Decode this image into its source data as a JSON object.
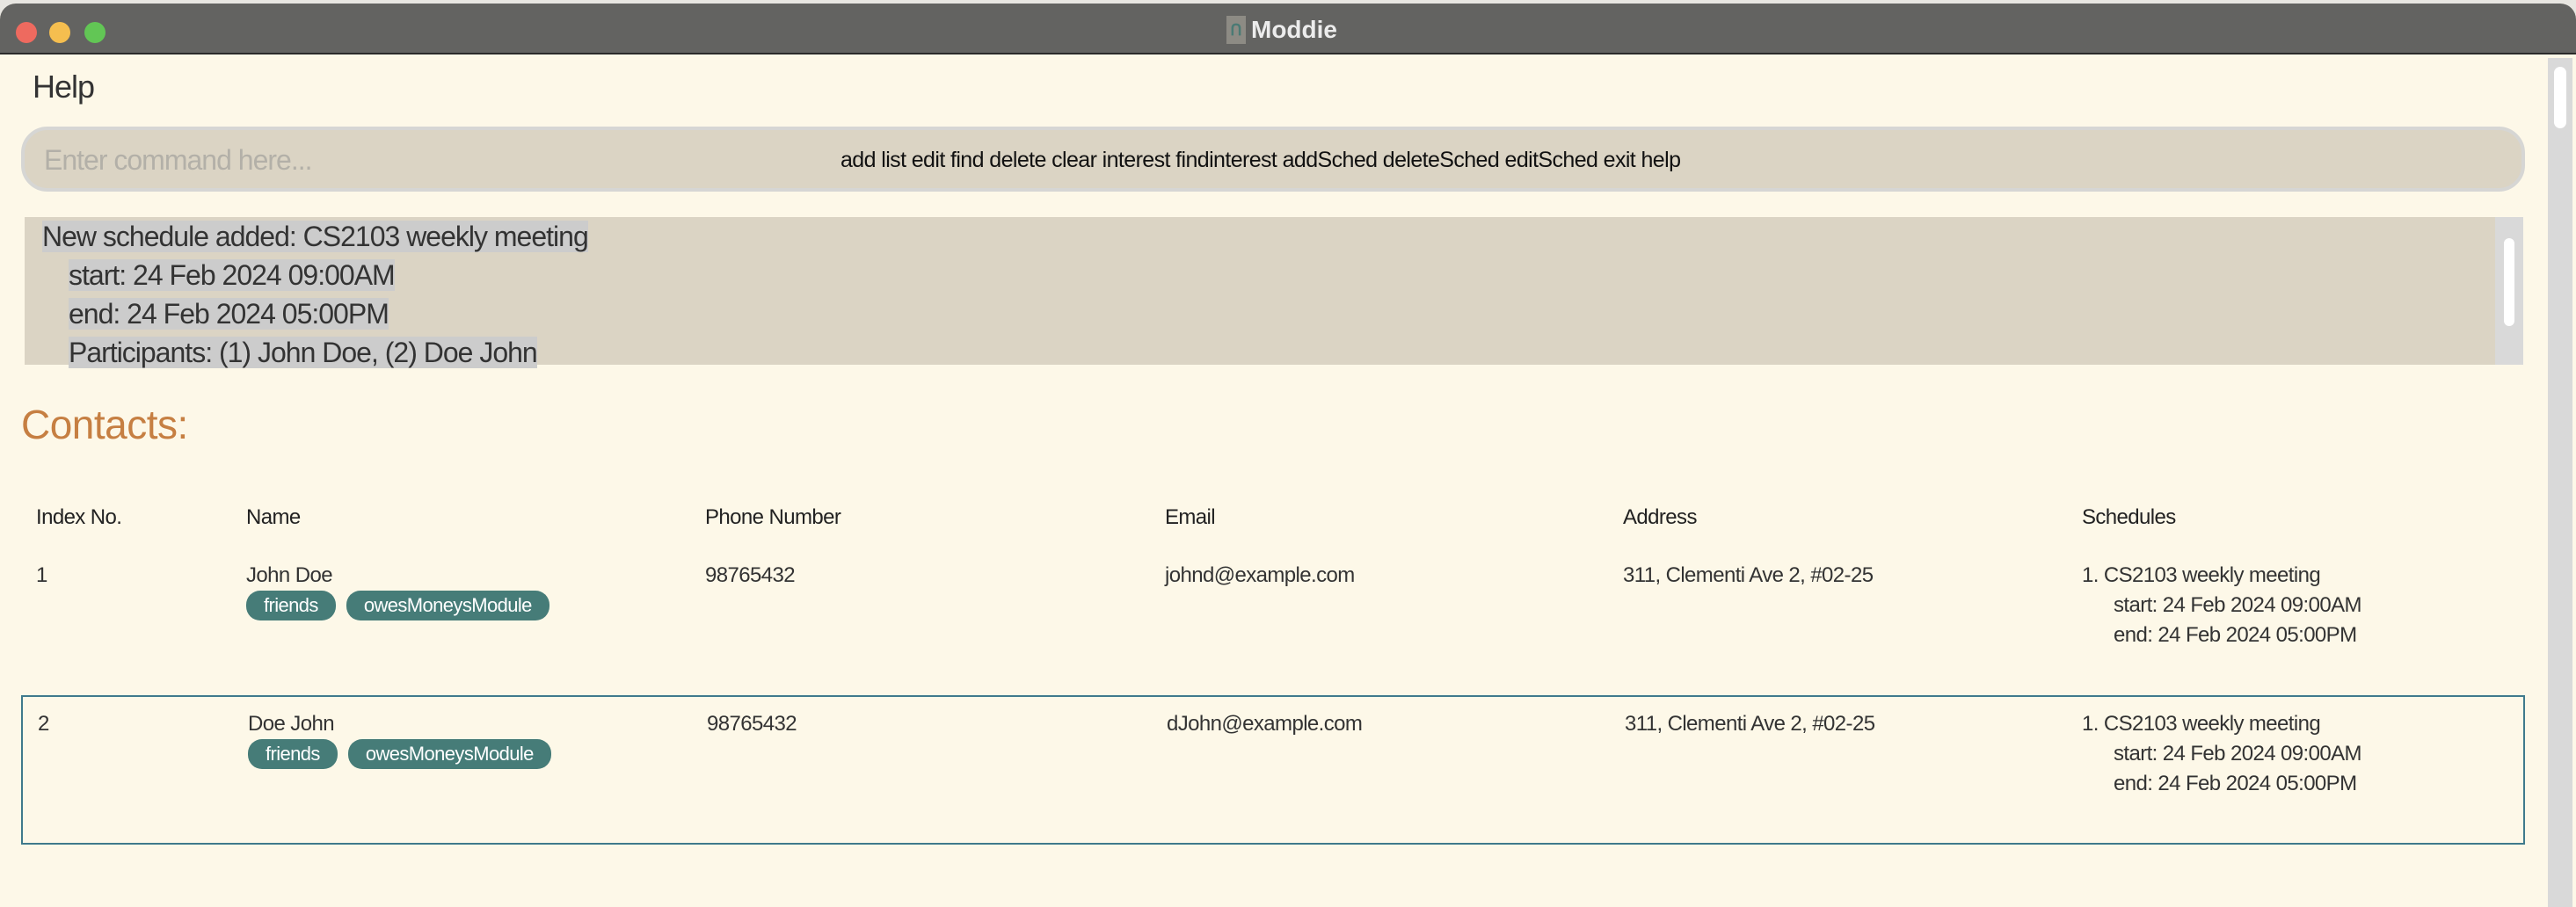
{
  "window": {
    "title": "Moddie",
    "app_icon": "moddie-logo-icon"
  },
  "menu": {
    "help": "Help"
  },
  "command": {
    "placeholder": "Enter command here...",
    "value": "",
    "hints": "add list edit find delete clear interest findinterest addSched deleteSched editSched exit help"
  },
  "result": {
    "lines": [
      "New schedule added: CS2103 weekly meeting",
      "start: 24 Feb 2024 09:00AM",
      "end: 24 Feb 2024 05:00PM",
      "Participants: (1) John Doe, (2) Doe John"
    ]
  },
  "contacts": {
    "title": "Contacts:",
    "headers": [
      "Index No.",
      "Name",
      "Phone Number",
      "Email",
      "Address",
      "Schedules"
    ],
    "rows": [
      {
        "index": "1",
        "name": "John Doe",
        "tags": [
          "friends",
          "owesMoneysModule"
        ],
        "phone": "98765432",
        "email": "johnd@example.com",
        "address": "311, Clementi Ave 2, #02-25",
        "schedule": {
          "title": "1. CS2103 weekly meeting",
          "start": "start: 24 Feb 2024 09:00AM",
          "end": "end: 24 Feb 2024 05:00PM"
        }
      },
      {
        "index": "2",
        "name": "Doe John",
        "tags": [
          "friends",
          "owesMoneysModule"
        ],
        "phone": "98765432",
        "email": "dJohn@example.com",
        "address": "311, Clementi Ave 2, #02-25",
        "schedule": {
          "title": "1. CS2103 weekly meeting",
          "start": "start: 24 Feb 2024 09:00AM",
          "end": "end: 24 Feb 2024 05:00PM"
        }
      }
    ]
  },
  "colors": {
    "accent": "#c67f42",
    "tag": "#467c78",
    "selection_border": "#3f7a8c",
    "background": "#fdf8e8"
  }
}
